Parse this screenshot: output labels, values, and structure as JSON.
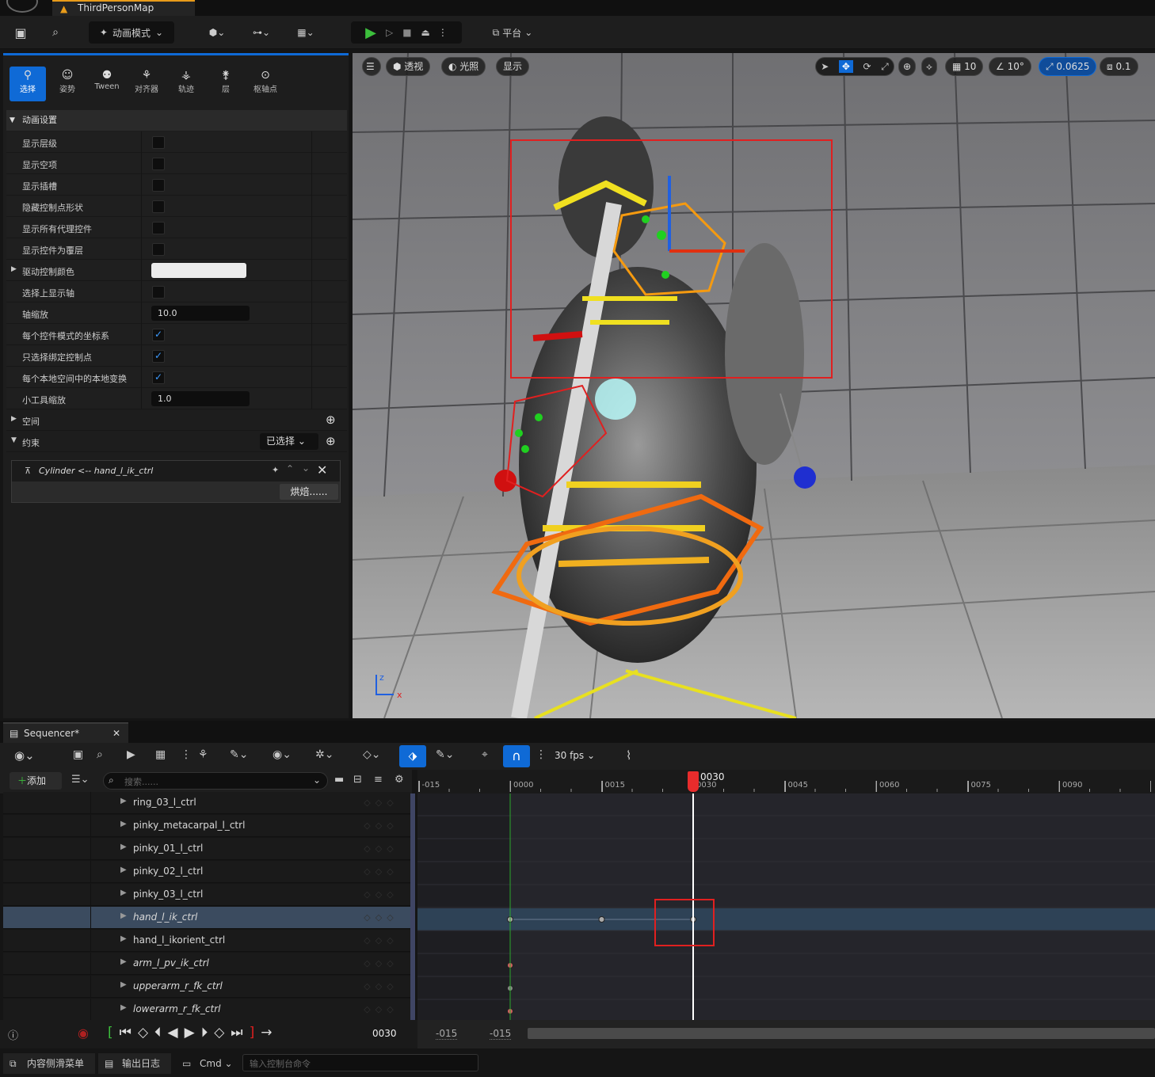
{
  "window": {
    "tab_title": "ThirdPersonMap"
  },
  "toolbar": {
    "mode_label": "动画模式",
    "platform_label": "平台"
  },
  "modes": [
    {
      "label": "选择",
      "active": true
    },
    {
      "label": "姿势"
    },
    {
      "label": "Tween"
    },
    {
      "label": "对齐器"
    },
    {
      "label": "轨迹"
    },
    {
      "label": "层"
    },
    {
      "label": "枢轴点"
    }
  ],
  "anim_settings": {
    "section_title": "动画设置",
    "rows": [
      {
        "label": "显示层级",
        "type": "checkbox",
        "checked": false
      },
      {
        "label": "显示空项",
        "type": "checkbox",
        "checked": false
      },
      {
        "label": "显示插槽",
        "type": "checkbox",
        "checked": false
      },
      {
        "label": "隐藏控制点形状",
        "type": "checkbox",
        "checked": false
      },
      {
        "label": "显示所有代理控件",
        "type": "checkbox",
        "checked": false
      },
      {
        "label": "显示控件为覆层",
        "type": "checkbox",
        "checked": false
      },
      {
        "label": "驱动控制颜色",
        "type": "color"
      },
      {
        "label": "选择上显示轴",
        "type": "checkbox",
        "checked": false
      },
      {
        "label": "轴缩放",
        "type": "number",
        "value": "10.0"
      },
      {
        "label": "每个控件模式的坐标系",
        "type": "checkbox",
        "checked": true
      },
      {
        "label": "只选择绑定控制点",
        "type": "checkbox",
        "checked": true
      },
      {
        "label": "每个本地空间中的本地变换",
        "type": "checkbox",
        "checked": true
      },
      {
        "label": "小工具缩放",
        "type": "number",
        "value": "1.0"
      }
    ]
  },
  "space_section": {
    "title": "空间"
  },
  "constraint_section": {
    "title": "约束",
    "dropdown": "已选择",
    "item": "Cylinder <-- hand_l_ik_ctrl",
    "bake_button": "烘焙......"
  },
  "viewport": {
    "perspective": "透视",
    "lighting": "光照",
    "show": "显示",
    "grid_snap": "10",
    "rot_snap": "10°",
    "scale_snap": "0.0625",
    "cam_speed": "0.1",
    "axis_z": "z",
    "axis_x": "x"
  },
  "sequencer": {
    "tab_title": "Sequencer*",
    "fps": "30 fps",
    "add_label": "添加",
    "search_placeholder": "搜索......",
    "tracks": [
      {
        "name": "ring_03_l_ctrl",
        "italic": false,
        "key_frames": []
      },
      {
        "name": "pinky_metacarpal_l_ctrl",
        "italic": false,
        "key_frames": []
      },
      {
        "name": "pinky_01_l_ctrl",
        "italic": false,
        "key_frames": []
      },
      {
        "name": "pinky_02_l_ctrl",
        "italic": false,
        "key_frames": []
      },
      {
        "name": "pinky_03_l_ctrl",
        "italic": false,
        "key_frames": []
      },
      {
        "name": "hand_l_ik_ctrl",
        "italic": true,
        "selected": true,
        "key_frames": [
          0,
          15,
          30
        ]
      },
      {
        "name": "hand_l_ikorient_ctrl",
        "italic": false,
        "key_frames": []
      },
      {
        "name": "arm_l_pv_ik_ctrl",
        "italic": true,
        "key_frames": [
          0
        ]
      },
      {
        "name": "upperarm_r_fk_ctrl",
        "italic": true,
        "key_frames": [
          0
        ]
      },
      {
        "name": "lowerarm_r_fk_ctrl",
        "italic": true,
        "key_frames": [
          0
        ]
      }
    ],
    "ruler_labels": [
      "-015",
      "0000",
      "0015",
      "0030",
      "0045",
      "0060",
      "0075",
      "0090"
    ],
    "playhead": "0030",
    "current_frame": "0030",
    "range_start": "-015",
    "range_end": "-015"
  },
  "statusbar": {
    "content_drawer": "内容侧滑菜单",
    "output_log": "输出日志",
    "cmd": "Cmd",
    "console_placeholder": "输入控制台命令"
  }
}
